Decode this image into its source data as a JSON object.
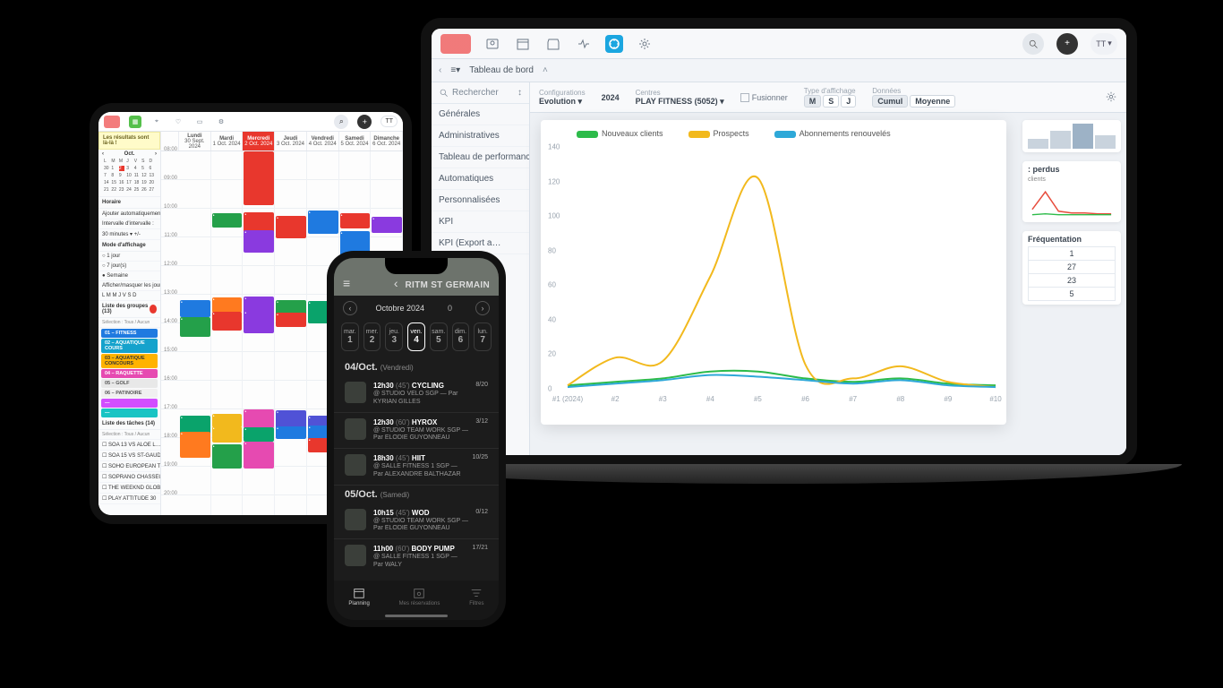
{
  "laptop": {
    "brand": "PLAY FITNESS",
    "account": "TT",
    "breadcrumb": "Tableau de bord",
    "sidebar_search": "Rechercher",
    "sidebar": [
      "Générales",
      "Administratives",
      "Tableau de performance",
      "Automatiques",
      "Personnalisées",
      "KPI",
      "KPI (Export a…"
    ],
    "filters": {
      "config_lbl": "Configurations",
      "config_val": "Evolution",
      "year": "2024",
      "centre_lbl": "Centres",
      "centre_val": "PLAY FITNESS (5052)",
      "merge": "Fusionner",
      "type_lbl": "Type d'affichage",
      "type_opts": [
        "M",
        "S",
        "J"
      ],
      "data_lbl": "Données",
      "data_opts": [
        "Cumul",
        "Moyenne"
      ]
    },
    "legend": [
      {
        "label": "Nouveaux clients",
        "color": "#2dbb4a"
      },
      {
        "label": "Prospects",
        "color": "#f2b91d"
      },
      {
        "label": "Abonnements renouvelés",
        "color": "#2ea8d8"
      }
    ],
    "side_cards": {
      "card1_title": ": perdus",
      "card1_sub": "clients",
      "freq_title": "Fréquentation",
      "freq_rows": [
        "1",
        "27",
        "23",
        "5"
      ]
    }
  },
  "chart_data": {
    "type": "line",
    "x": [
      "#1 (2024)",
      "#2",
      "#3",
      "#4",
      "#5",
      "#6",
      "#7",
      "#8",
      "#9",
      "#10"
    ],
    "ylim": [
      0,
      140
    ],
    "yticks": [
      0,
      20,
      40,
      60,
      80,
      100,
      120,
      140
    ],
    "series": [
      {
        "name": "Nouveaux clients",
        "color": "#2dbb4a",
        "values": [
          2,
          4,
          6,
          10,
          10,
          6,
          4,
          6,
          3,
          2
        ]
      },
      {
        "name": "Prospects",
        "color": "#f2b91d",
        "values": [
          2,
          18,
          16,
          65,
          122,
          14,
          6,
          13,
          4,
          1
        ]
      },
      {
        "name": "Abonnements renouvelés",
        "color": "#2ea8d8",
        "values": [
          1,
          3,
          5,
          8,
          7,
          5,
          3,
          5,
          2,
          1
        ]
      }
    ]
  },
  "tablet": {
    "account": "TT",
    "banner": "Les résultats sont là-là !",
    "month_left": "‹",
    "month_right": "›",
    "month_label": "Oct.",
    "days": [
      {
        "dw": "Lundi",
        "dt": "30 Sept. 2024"
      },
      {
        "dw": "Mardi",
        "dt": "1 Oct. 2024"
      },
      {
        "dw": "Mercredi",
        "dt": "2 Oct. 2024",
        "sel": true
      },
      {
        "dw": "Jeudi",
        "dt": "3 Oct. 2024"
      },
      {
        "dw": "Vendredi",
        "dt": "4 Oct. 2024"
      },
      {
        "dw": "Samedi",
        "dt": "5 Oct. 2024"
      },
      {
        "dw": "Dimanche",
        "dt": "6 Oct. 2024"
      }
    ],
    "left": {
      "horaire": "Horaire",
      "ajouter": "Ajouter automatiquement ▾",
      "intervalle": "Intervalle d'intervalle :",
      "interval_val": "30 minutes ▾   +/-",
      "mode": "Mode d'affichage",
      "mode_opts": [
        "1 jour",
        "7 jour(s)",
        "Semaine"
      ],
      "mask": "Afficher/masquer les jours",
      "mask_row": "L M M J V S D",
      "groups_title": "Liste des groupes (13)",
      "groups_filter": "Sélection : Tous / Aucun",
      "groups": [
        "01 – FITNESS",
        "02 – AQUATIQUE COURS",
        "03 – AQUATIQUE CONCOURS",
        "04 – RAQUETTE",
        "05 – GOLF",
        "06 – PATINOIRE",
        "—",
        "—"
      ],
      "tasks_title": "Liste des tâches (14)",
      "tasks_filter": "Sélection : Tous / Aucun",
      "tasks": [
        "SOA 13 VS ALOE L…",
        "SOA 15 VS ST-GAUDENS…",
        "SOHO EUROPEAN TOUR",
        "SOPRANO CHASSEUR OCTO…",
        "THE WEEKND GLOBAL STAD…",
        "PLAY ATTITUDE 30"
      ]
    },
    "hours": [
      "08:00",
      "09:00",
      "10:00",
      "11:00",
      "12:00",
      "13:00",
      "14:00",
      "15:00",
      "16:00",
      "17:00",
      "18:00",
      "19:00",
      "20:00"
    ]
  },
  "phone": {
    "title": "RITM ST GERMAIN",
    "month": "Octobre 2024",
    "days": [
      {
        "w": "mar.",
        "n": "1"
      },
      {
        "w": "mer.",
        "n": "2"
      },
      {
        "w": "jeu.",
        "n": "3"
      },
      {
        "w": "ven.",
        "n": "4",
        "sel": true
      },
      {
        "w": "sam.",
        "n": "5"
      },
      {
        "w": "dim.",
        "n": "6"
      },
      {
        "w": "lun.",
        "n": "7"
      }
    ],
    "sections": [
      {
        "hdr": "04/Oct.",
        "sub": "(Vendredi)",
        "items": [
          {
            "time": "12h30",
            "dur": "(45')",
            "name": "CYCLING",
            "loc": "@ STUDIO VELO SGP — Par KYRIAN GILLES",
            "cap": "8/20"
          },
          {
            "time": "12h30",
            "dur": "(60')",
            "name": "HYROX",
            "loc": "@ STUDIO TEAM WORK SGP — Par ELODIE GUYONNEAU",
            "cap": "3/12"
          },
          {
            "time": "18h30",
            "dur": "(45')",
            "name": "HIIT",
            "loc": "@ SALLE FITNESS 1 SGP — Par ALEXANDRE BALTHAZAR",
            "cap": "10/25"
          }
        ]
      },
      {
        "hdr": "05/Oct.",
        "sub": "(Samedi)",
        "items": [
          {
            "time": "10h15",
            "dur": "(45')",
            "name": "WOD",
            "loc": "@ STUDIO TEAM WORK SGP — Par ELODIE GUYONNEAU",
            "cap": "0/12"
          },
          {
            "time": "11h00",
            "dur": "(60')",
            "name": "BODY PUMP",
            "loc": "@ SALLE FITNESS 1 SGP — Par WALY",
            "cap": "17/21"
          }
        ]
      }
    ],
    "tabs": [
      "Planning",
      "Mes réservations",
      "Filtres"
    ]
  }
}
